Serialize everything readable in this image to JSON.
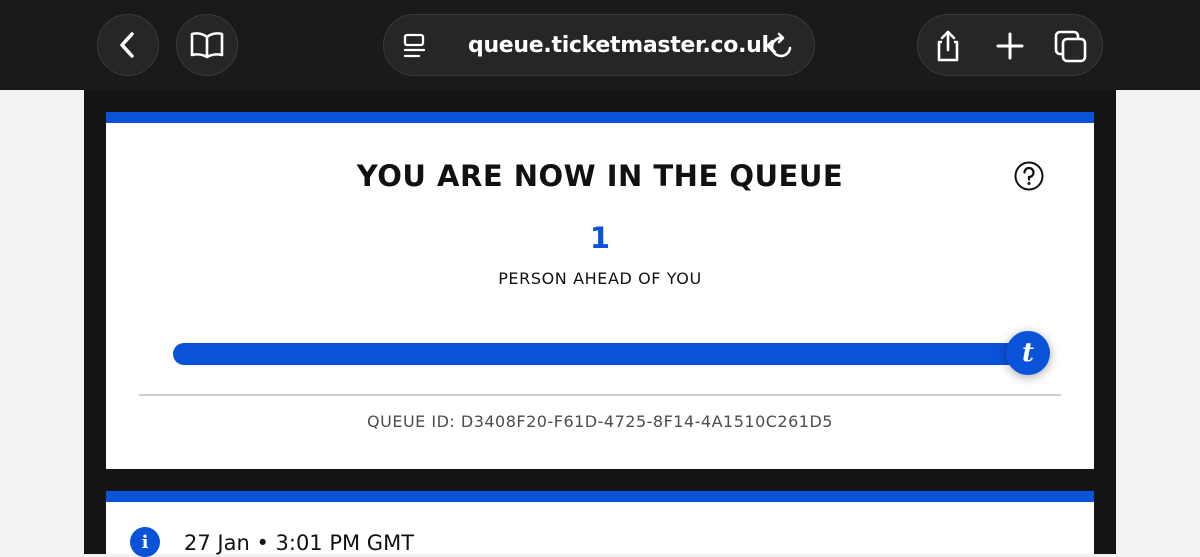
{
  "browser": {
    "url": "queue.ticketmaster.co.uk",
    "icons": {
      "back": "chevron-left-icon",
      "bookmarks": "book-icon",
      "reader": "reader-mode-icon",
      "reload": "reload-icon",
      "share": "share-icon",
      "new_tab": "plus-icon",
      "tabs": "tabs-icon"
    }
  },
  "queue": {
    "title": "YOU ARE NOW IN THE QUEUE",
    "people_ahead": "1",
    "ahead_label": "PERSON AHEAD OF YOU",
    "progress": 1.0,
    "marker_glyph": "t",
    "queue_id": "QUEUE ID: D3408F20-F61D-4725-8F14-4A1510C261D5"
  },
  "info": {
    "icon_glyph": "i",
    "text": "27 Jan • 3:01 PM GMT"
  },
  "colors": {
    "accent": "#0a53d8",
    "chrome": "#1a1a1a",
    "page_frame": "#141414"
  }
}
